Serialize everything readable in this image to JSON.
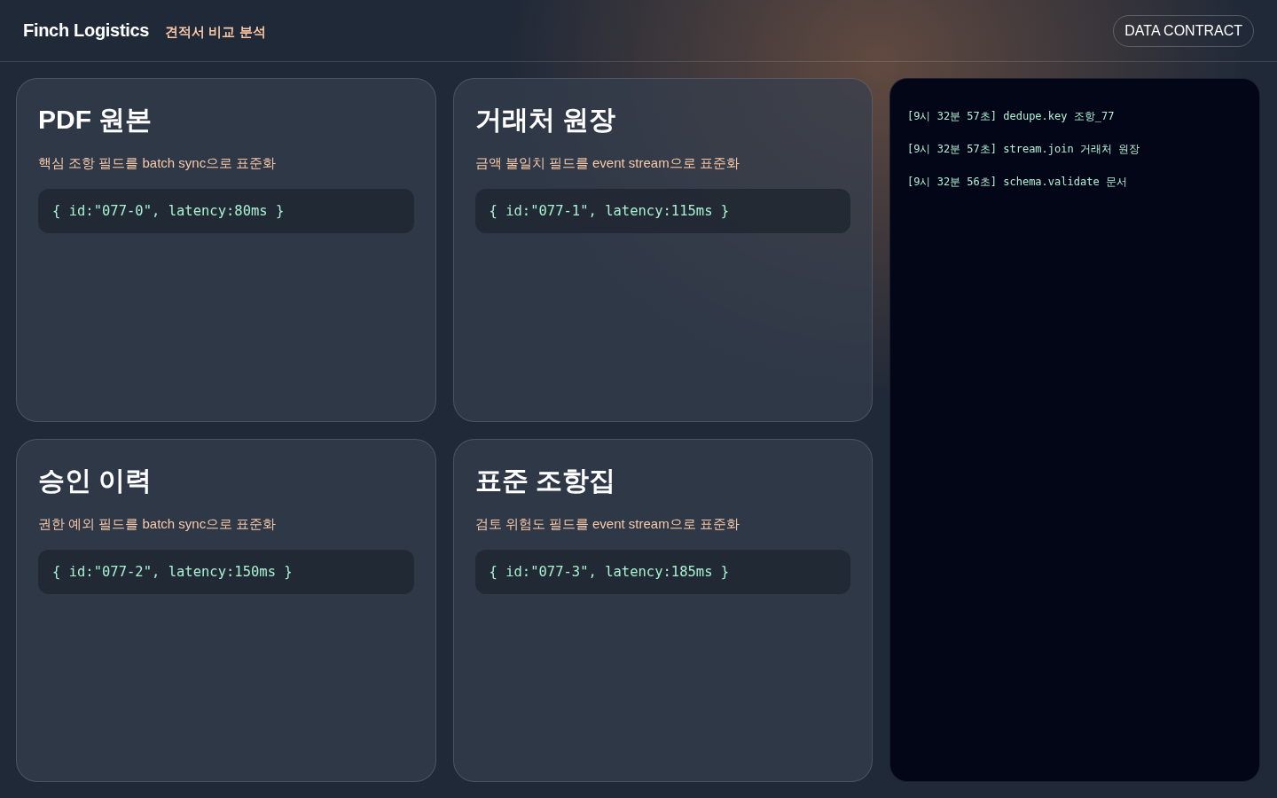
{
  "header": {
    "brand": "Finch Logistics",
    "subtitle": "견적서 비교 분석",
    "button": "DATA CONTRACT"
  },
  "cards": [
    {
      "title": "PDF 원본",
      "description": "핵심 조항 필드를 batch sync으로 표준화",
      "code": "{ id:\"077-0\", latency:80ms }"
    },
    {
      "title": "거래처 원장",
      "description": "금액 불일치 필드를 event stream으로 표준화",
      "code": "{ id:\"077-1\", latency:115ms }"
    },
    {
      "title": "승인 이력",
      "description": "권한 예외 필드를 batch sync으로 표준화",
      "code": "{ id:\"077-2\", latency:150ms }"
    },
    {
      "title": "표준 조항집",
      "description": "검토 위험도 필드를 event stream으로 표준화",
      "code": "{ id:\"077-3\", latency:185ms }"
    }
  ],
  "log": [
    "[9시 32분 57초] dedupe.key 조항_77",
    "[9시 32분 57초] stream.join 거래처 원장",
    "[9시 32분 56초] schema.validate 문서"
  ]
}
